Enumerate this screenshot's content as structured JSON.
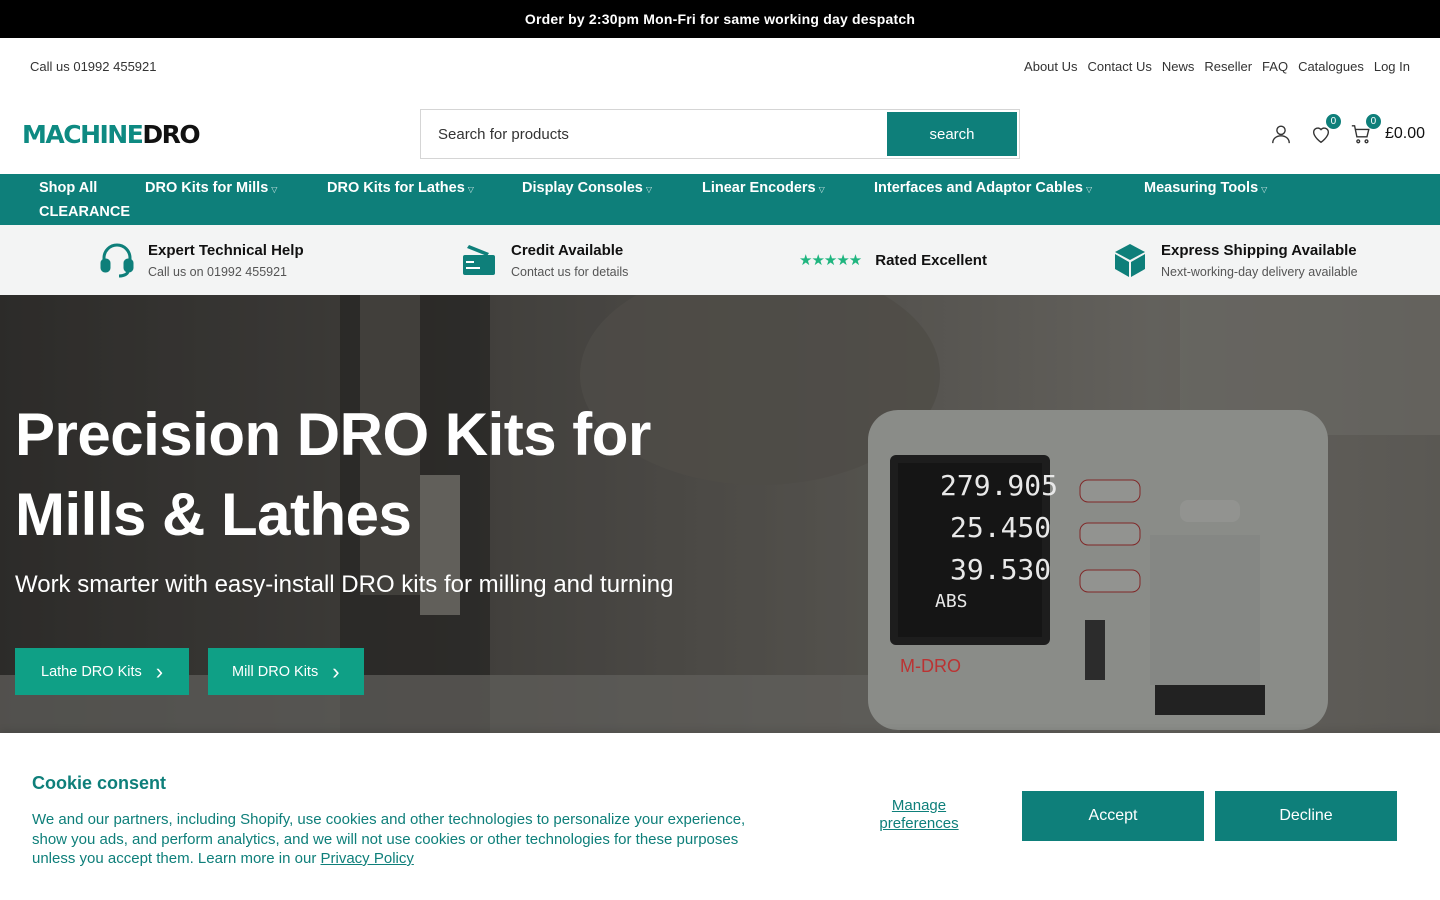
{
  "announcement": "Order by 2:30pm Mon-Fri for same working day despatch",
  "utility": {
    "phone": "Call us 01992 455921",
    "links": [
      "About Us",
      "Contact Us",
      "News",
      "Reseller",
      "FAQ",
      "Catalogues",
      "Log In"
    ]
  },
  "logo": {
    "part1": "MACHINE",
    "part2": "DRO"
  },
  "search": {
    "placeholder": "Search for products",
    "button": "search"
  },
  "header": {
    "wishlist_count": "0",
    "cart_count": "0",
    "cart_total": "£0.00"
  },
  "nav": [
    {
      "label": "Shop All",
      "dropdown": false
    },
    {
      "label": "DRO Kits for Mills",
      "dropdown": true
    },
    {
      "label": "DRO Kits for Lathes",
      "dropdown": true
    },
    {
      "label": "Display Consoles",
      "dropdown": true
    },
    {
      "label": "Linear Encoders",
      "dropdown": true
    },
    {
      "label": "Interfaces and Adaptor Cables",
      "dropdown": true
    },
    {
      "label": "Measuring Tools",
      "dropdown": true
    },
    {
      "label": "CLEARANCE",
      "dropdown": false
    }
  ],
  "usp": [
    {
      "title": "Expert Technical Help",
      "sub": "Call us on 01992 455921",
      "icon": "headset-icon"
    },
    {
      "title": "Credit Available",
      "sub": "Contact us for details",
      "icon": "credit-icon"
    },
    {
      "title": "Rated Excellent",
      "sub": "",
      "icon": "stars-icon",
      "stars": "★★★★★"
    },
    {
      "title": "Express Shipping Available",
      "sub": "Next-working-day delivery available",
      "icon": "box-icon"
    }
  ],
  "hero": {
    "title": "Precision DRO Kits for Mills & Lathes",
    "subtitle": "Work smarter with easy-install DRO kits for milling and turning",
    "buttons": [
      "Lathe DRO Kits",
      "Mill DRO Kits"
    ],
    "readout": [
      "279.905",
      "25.450",
      "39.530",
      "ABS"
    ],
    "device_brand": "M-DRO"
  },
  "cookie": {
    "title": "Cookie consent",
    "text": "We and our partners, including Shopify, use cookies and other technologies to personalize your experience, show you ads, and perform analytics, and we will not use cookies or other technologies for these purposes unless you accept them. Learn more in our ",
    "privacy_link": "Privacy Policy",
    "manage": "Manage preferences",
    "accept": "Accept",
    "decline": "Decline"
  },
  "colors": {
    "brand": "#0e7f7a",
    "button": "#0fa086",
    "stars": "#1fb57f"
  }
}
